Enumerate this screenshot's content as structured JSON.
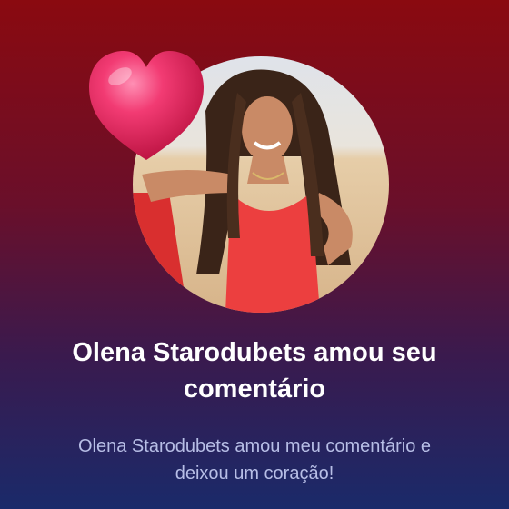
{
  "notification": {
    "title": "Olena Starodubets amou seu comentário",
    "message": "Olena Starodubets amou meu comentário e deixou um coração!"
  },
  "icons": {
    "reaction": "heart-icon"
  },
  "colors": {
    "background_top": "#8a0a10",
    "background_bottom": "#1a2a6a",
    "heart": "#e8245a",
    "title_text": "#ffffff",
    "message_text": "#b7bee6"
  }
}
